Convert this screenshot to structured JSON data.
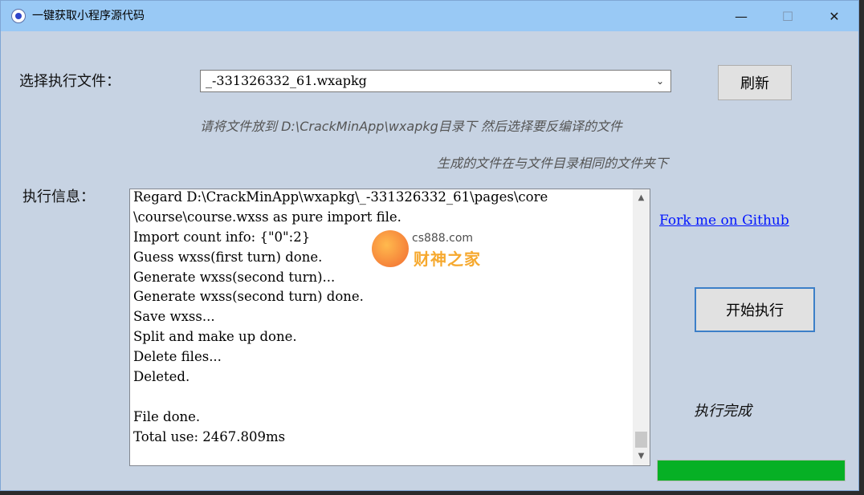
{
  "window": {
    "title": "一键获取小程序源代码",
    "controls": {
      "minimize": "—",
      "maximize": "☐",
      "close": "✕"
    }
  },
  "file_select": {
    "label": "选择执行文件：",
    "selected_value": "_-331326332_61.wxapkg",
    "refresh_label": "刷新"
  },
  "hints": {
    "line1": "请将文件放到   D:\\CrackMinApp\\wxapkg目录下 然后选择要反编译的文件",
    "line2": "生成的文件在与文件目录相同的文件夹下"
  },
  "log": {
    "label": "执行信息：",
    "lines": [
      "Regard D:\\CrackMinApp\\wxapkg\\_-331326332_61\\pages\\core",
      "\\course\\course.wxss as pure import file.",
      "Import count info: {\"0\":2}",
      "Guess wxss(first turn) done.",
      "Generate wxss(second turn)...",
      "Generate wxss(second turn) done.",
      "Save wxss...",
      "Split and make up done.",
      "Delete files...",
      "Deleted.",
      "",
      "File done.",
      "Total use: 2467.809ms"
    ]
  },
  "github_link": "Fork me on Github",
  "start_button": "开始执行",
  "status": "执行完成",
  "progress": {
    "percent": 100,
    "color": "#06b025"
  },
  "watermark": {
    "url": "cs888.com",
    "text": "财神之家"
  }
}
